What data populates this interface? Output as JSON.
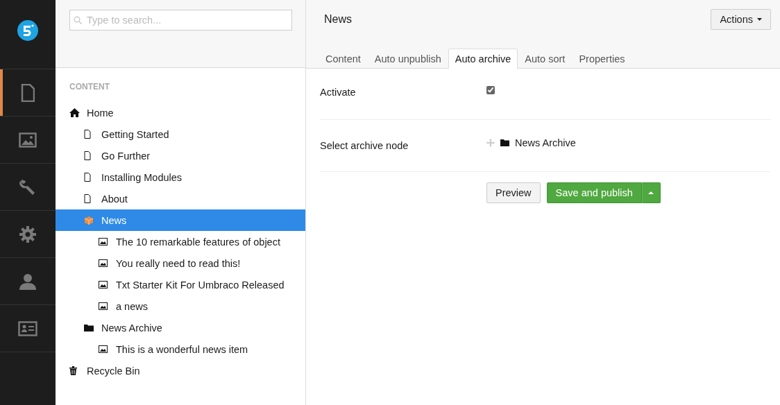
{
  "nav": [
    {
      "kind": "document",
      "selected": true
    },
    {
      "kind": "media",
      "selected": false
    },
    {
      "kind": "wrench",
      "selected": false
    },
    {
      "kind": "gear",
      "selected": false
    },
    {
      "kind": "user",
      "selected": false
    },
    {
      "kind": "card",
      "selected": false
    }
  ],
  "search": {
    "placeholder": "Type to search..."
  },
  "tree": {
    "heading": "CONTENT",
    "items": [
      {
        "label": "Home",
        "kind": "home",
        "selected": false,
        "children": [
          {
            "label": "Getting Started",
            "kind": "document",
            "selected": false
          },
          {
            "label": "Go Further",
            "kind": "document",
            "selected": false
          },
          {
            "label": "Installing Modules",
            "kind": "document",
            "selected": false
          },
          {
            "label": "About",
            "kind": "document",
            "selected": false
          },
          {
            "label": "News",
            "kind": "box",
            "selected": true,
            "children": [
              {
                "label": "The 10 remarkable features of object",
                "kind": "image",
                "selected": false
              },
              {
                "label": "You really need to read this!",
                "kind": "image",
                "selected": false
              },
              {
                "label": "Txt Starter Kit For Umbraco Released",
                "kind": "image",
                "selected": false
              },
              {
                "label": "a news",
                "kind": "image",
                "selected": false
              }
            ]
          },
          {
            "label": "News Archive",
            "kind": "folder",
            "selected": false,
            "children": [
              {
                "label": "This is a wonderful news item",
                "kind": "image",
                "selected": false
              }
            ]
          }
        ]
      },
      {
        "label": "Recycle Bin",
        "kind": "trash",
        "selected": false
      }
    ]
  },
  "editor": {
    "title": "News",
    "actions": "Actions",
    "tabs": [
      {
        "label": "Content",
        "selected": false
      },
      {
        "label": "Auto unpublish",
        "selected": false
      },
      {
        "label": "Auto archive",
        "selected": true
      },
      {
        "label": "Auto sort",
        "selected": false
      },
      {
        "label": "Properties",
        "selected": false
      }
    ],
    "fields": [
      {
        "kind": "checkbox",
        "label": "Activate",
        "checked": true
      },
      {
        "kind": "node-picker",
        "label": "Select archive node",
        "value": "News Archive"
      }
    ],
    "buttons": {
      "preview": "Preview",
      "publish": "Save and publish"
    }
  }
}
